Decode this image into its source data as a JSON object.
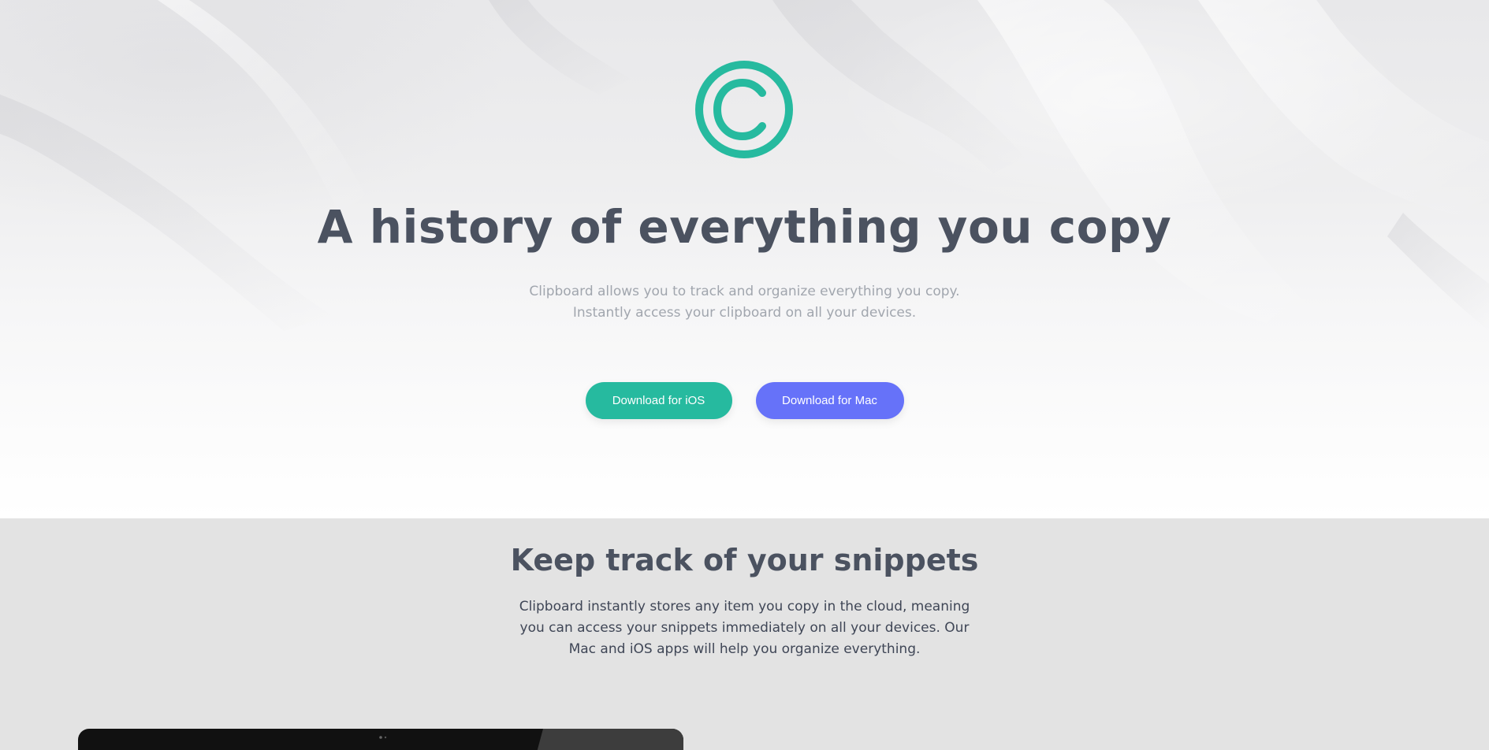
{
  "hero": {
    "title": "A history of everything you copy",
    "subtitle_line1": "Clipboard allows you to track and organize everything you copy.",
    "subtitle_line2": "Instantly access your clipboard on all your devices.",
    "buttons": {
      "ios_label": "Download for iOS",
      "mac_label": "Download for Mac"
    }
  },
  "features": {
    "title": "Keep track of your snippets",
    "text_line1": "Clipboard instantly stores any item you copy in the cloud, meaning",
    "text_line2": "you can access your snippets immediately on all your devices. Our",
    "text_line3": "Mac and iOS apps will help you organize everything."
  },
  "colors": {
    "accent_green": "#26ba9f",
    "accent_blue": "#6672f9",
    "heading": "#4b5260",
    "subtext": "#a1a6ae",
    "section_bg": "#e3e3e3"
  },
  "icons": {
    "brand_logo": "copyright-logo-icon",
    "device_camera": "camera-icon"
  }
}
